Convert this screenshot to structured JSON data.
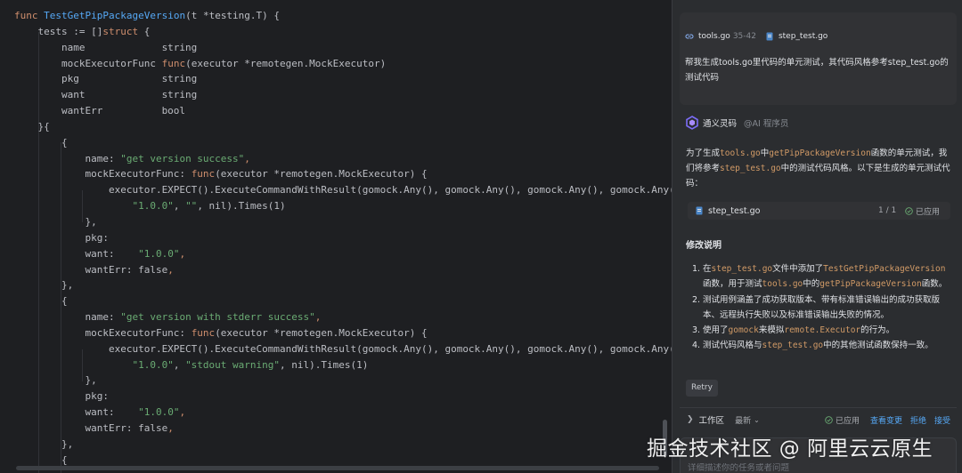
{
  "editor": {
    "lines": [
      [
        {
          "c": "kw",
          "t": "func "
        },
        {
          "c": "fn",
          "t": "TestGetPipPackageVersion"
        },
        {
          "c": "plain",
          "t": "(t *testing.T) {"
        }
      ],
      [
        {
          "c": "plain",
          "t": "    tests := []"
        },
        {
          "c": "kw",
          "t": "struct"
        },
        {
          "c": "plain",
          "t": " {"
        }
      ],
      [
        {
          "c": "plain",
          "t": "        name             string"
        }
      ],
      [
        {
          "c": "plain",
          "t": "        mockExecutorFunc "
        },
        {
          "c": "kw",
          "t": "func"
        },
        {
          "c": "plain",
          "t": "(executor *remotegen.MockExecutor)"
        }
      ],
      [
        {
          "c": "plain",
          "t": "        pkg              string"
        }
      ],
      [
        {
          "c": "plain",
          "t": "        want             string"
        }
      ],
      [
        {
          "c": "plain",
          "t": "        wantErr          bool"
        }
      ],
      [
        {
          "c": "plain",
          "t": "    }{"
        }
      ],
      [
        {
          "c": "plain",
          "t": "        {"
        }
      ],
      [
        {
          "c": "plain",
          "t": "            name: "
        },
        {
          "c": "str",
          "t": "\"get version success\""
        },
        {
          "c": "kw",
          "t": ","
        }
      ],
      [
        {
          "c": "plain",
          "t": "            mockExecutorFunc: "
        },
        {
          "c": "kw",
          "t": "func"
        },
        {
          "c": "plain",
          "t": "(executor *remotegen.MockExecutor) {"
        }
      ],
      [
        {
          "c": "plain",
          "t": "                executor.EXPECT().ExecuteCommandWithResult(gomock.Any(), gomock.Any(), gomock.Any(), gomock.Any()).Ret"
        }
      ],
      [
        {
          "c": "plain",
          "t": "                    "
        },
        {
          "c": "str",
          "t": "\"1.0.0\""
        },
        {
          "c": "plain",
          "t": ", "
        },
        {
          "c": "str",
          "t": "\"\""
        },
        {
          "c": "plain",
          "t": ", nil).Times(1)"
        }
      ],
      [
        {
          "c": "plain",
          "t": "            },"
        }
      ],
      [
        {
          "c": "plain",
          "t": "            pkg:"
        }
      ],
      [
        {
          "c": "plain",
          "t": "            want:    "
        },
        {
          "c": "str",
          "t": "\"1.0.0\""
        },
        {
          "c": "kw",
          "t": ","
        }
      ],
      [
        {
          "c": "plain",
          "t": "            wantErr: false"
        },
        {
          "c": "kw",
          "t": ","
        }
      ],
      [
        {
          "c": "plain",
          "t": "        },"
        }
      ],
      [
        {
          "c": "plain",
          "t": "        {"
        }
      ],
      [
        {
          "c": "plain",
          "t": "            name: "
        },
        {
          "c": "str",
          "t": "\"get version with stderr success\""
        },
        {
          "c": "kw",
          "t": ","
        }
      ],
      [
        {
          "c": "plain",
          "t": "            mockExecutorFunc: "
        },
        {
          "c": "kw",
          "t": "func"
        },
        {
          "c": "plain",
          "t": "(executor *remotegen.MockExecutor) {"
        }
      ],
      [
        {
          "c": "plain",
          "t": "                executor.EXPECT().ExecuteCommandWithResult(gomock.Any(), gomock.Any(), gomock.Any(), gomock.Any()).Ret"
        }
      ],
      [
        {
          "c": "plain",
          "t": "                    "
        },
        {
          "c": "str",
          "t": "\"1.0.0\""
        },
        {
          "c": "plain",
          "t": ", "
        },
        {
          "c": "str",
          "t": "\"stdout warning\""
        },
        {
          "c": "plain",
          "t": ", nil).Times(1)"
        }
      ],
      [
        {
          "c": "plain",
          "t": "            },"
        }
      ],
      [
        {
          "c": "plain",
          "t": "            pkg:"
        }
      ],
      [
        {
          "c": "plain",
          "t": "            want:    "
        },
        {
          "c": "str",
          "t": "\"1.0.0\""
        },
        {
          "c": "kw",
          "t": ","
        }
      ],
      [
        {
          "c": "plain",
          "t": "            wantErr: false"
        },
        {
          "c": "kw",
          "t": ","
        }
      ],
      [
        {
          "c": "plain",
          "t": "        },"
        }
      ],
      [
        {
          "c": "plain",
          "t": "        {"
        }
      ]
    ]
  },
  "chat": {
    "user_message": {
      "context_file_1": "tools.go",
      "context_range_1": "35-42",
      "context_file_2": "step_test.go",
      "text": "帮我生成tools.go里代码的单元测试，其代码风格参考step_test.go的测试代码"
    },
    "bot": {
      "name": "通义灵码",
      "role": "@AI 程序员",
      "intro": [
        {
          "t": "为了生成"
        },
        {
          "t": "tools.go",
          "code": true
        },
        {
          "t": "中"
        },
        {
          "t": "getPipPackageVersion",
          "code": true
        },
        {
          "t": "函数的单元测试，我们将参考"
        },
        {
          "t": "step_test.go",
          "code": true
        },
        {
          "t": "中的测试代码风格。以下是生成的单元测试代码："
        }
      ],
      "file_card": {
        "name": "step_test.go",
        "count": "1 / 1",
        "status": "已应用"
      },
      "section_title": "修改说明",
      "items": [
        {
          "num": "1.",
          "parts": [
            {
              "t": "在"
            },
            {
              "t": "step_test.go",
              "code": true
            },
            {
              "t": "文件中添加了"
            },
            {
              "t": "TestGetPipPackageVersion",
              "code": true
            },
            {
              "t": "函数，用于测试"
            },
            {
              "t": "tools.go",
              "code": true
            },
            {
              "t": "中的"
            },
            {
              "t": "getPipPackageVersion",
              "code": true
            },
            {
              "t": "函数。"
            }
          ]
        },
        {
          "num": "2.",
          "parts": [
            {
              "t": "测试用例涵盖了成功获取版本、带有标准错误输出的成功获取版本、远程执行失败以及标准错误输出失败的情况。"
            }
          ]
        },
        {
          "num": "3.",
          "parts": [
            {
              "t": "使用了"
            },
            {
              "t": "gomock",
              "code": true
            },
            {
              "t": "来模拟"
            },
            {
              "t": "remote.Executor",
              "code": true
            },
            {
              "t": "的行为。"
            }
          ]
        },
        {
          "num": "4.",
          "parts": [
            {
              "t": "测试代码风格与"
            },
            {
              "t": "step_test.go",
              "code": true
            },
            {
              "t": "中的其他测试函数保持一致。"
            }
          ]
        }
      ],
      "retry_label": "Retry"
    },
    "workspace": {
      "label": "工作区",
      "latest": "最新",
      "applied": "已应用",
      "view_changes": "查看变更",
      "reject": "拒绝",
      "accept": "接受"
    },
    "input": {
      "placeholder": "详细描述你的任务或者问题"
    }
  },
  "watermark": "掘金技术社区 @ 阿里云云原生",
  "colors": {
    "keyword": "#cf8e6d",
    "function": "#56a8f5",
    "string": "#6aab73",
    "inline_code": "#d19a66",
    "link": "#56a8f5"
  }
}
